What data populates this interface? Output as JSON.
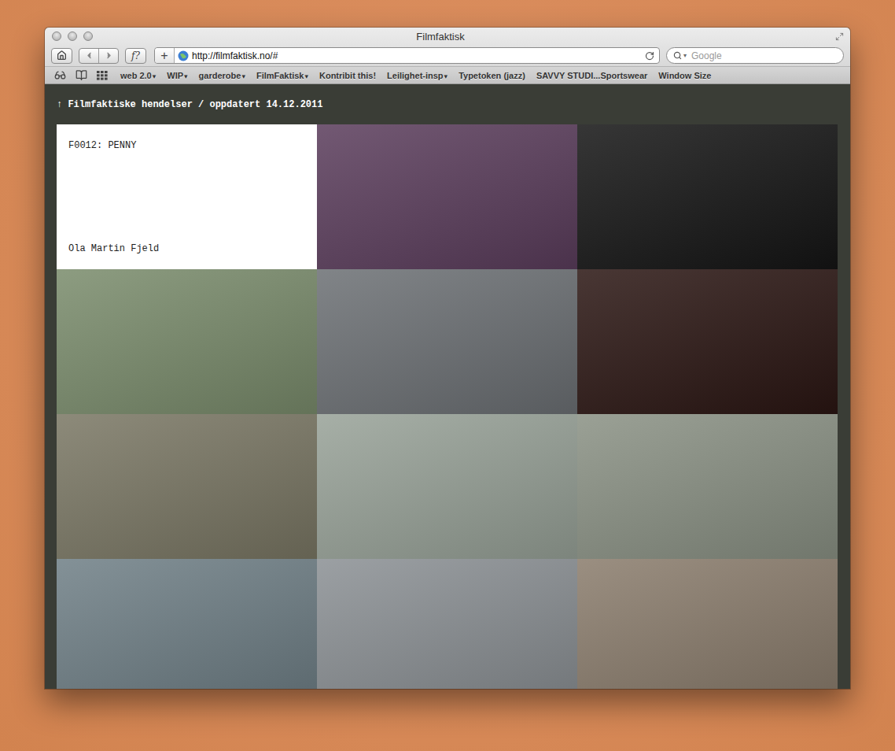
{
  "window": {
    "title": "Filmfaktisk"
  },
  "toolbar": {
    "reader_button": "f?",
    "add_button": "+",
    "url": "http://filmfaktisk.no/#",
    "search_placeholder": "Google"
  },
  "bookmarks": [
    {
      "label": "web 2.0",
      "arrow": "▾"
    },
    {
      "label": "WIP",
      "arrow": "▾"
    },
    {
      "label": "garderobe",
      "arrow": "▾"
    },
    {
      "label": "FilmFaktisk",
      "arrow": "▾"
    },
    {
      "label": "Kontribit this!"
    },
    {
      "label": "Leilighet-insp",
      "arrow": "▾"
    },
    {
      "label": "Typetoken (jazz)"
    },
    {
      "label": "SAVVY STUDI...Sportswear"
    },
    {
      "label": "Window Size"
    }
  ],
  "page": {
    "header": "↑ Filmfaktiske hendelser / oppdatert 14.12.2011",
    "tiles": [
      {
        "kind": "card",
        "title": "F0012: PENNY",
        "author": "Ola Martin Fjeld"
      },
      {
        "kind": "photo",
        "color": "#5b3d5c"
      },
      {
        "kind": "photo",
        "color": "#151515"
      },
      {
        "kind": "photo",
        "color": "#7a8c6c"
      },
      {
        "kind": "photo",
        "color": "#6c7074"
      },
      {
        "kind": "photo",
        "color": "#2b1613"
      },
      {
        "kind": "photo",
        "color": "#7a7764"
      },
      {
        "kind": "photo",
        "color": "#98a298"
      },
      {
        "kind": "photo",
        "color": "#8a9184"
      },
      {
        "kind": "photo",
        "color": "#6f7f86"
      },
      {
        "kind": "photo",
        "color": "#8b9094"
      },
      {
        "kind": "photo",
        "color": "#8a7c6c"
      }
    ]
  }
}
